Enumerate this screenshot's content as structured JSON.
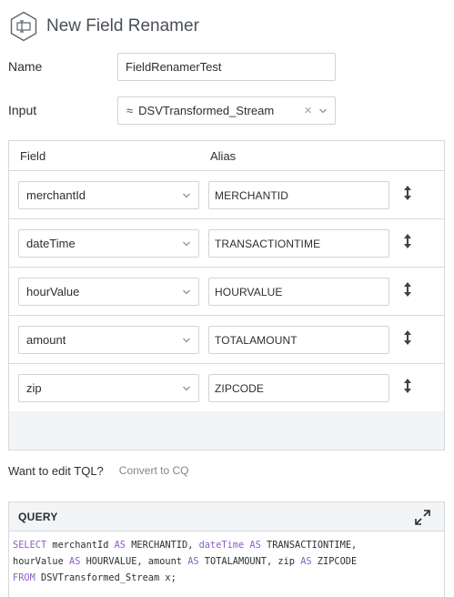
{
  "header": {
    "title": "New Field Renamer",
    "icon": "field-renamer-icon"
  },
  "name": {
    "label": "Name",
    "value": "FieldRenamerTest"
  },
  "input": {
    "label": "Input",
    "value": "DSVTransformed_Stream",
    "stream_icon": "≈",
    "clear_icon": "×"
  },
  "table": {
    "col_field": "Field",
    "col_alias": "Alias",
    "rows": [
      {
        "field": "merchantId",
        "alias": "MERCHANTID"
      },
      {
        "field": "dateTime",
        "alias": "TRANSACTIONTIME"
      },
      {
        "field": "hourValue",
        "alias": "HOURVALUE"
      },
      {
        "field": "amount",
        "alias": "TOTALAMOUNT"
      },
      {
        "field": "zip",
        "alias": "ZIPCODE"
      }
    ]
  },
  "tql": {
    "question": "Want to edit TQL?",
    "link": "Convert to CQ"
  },
  "query": {
    "title": "QUERY",
    "line1": {
      "kw1": "SELECT",
      "t1": " merchantId ",
      "kw2": "AS",
      "t2": " MERCHANTID, ",
      "kw3": "dateTime",
      "t3": " ",
      "kw4": "AS",
      "t4": " TRANSACTIONTIME,"
    },
    "line2": {
      "t1": "hourValue ",
      "kw1": "AS",
      "t2": " HOURVALUE, amount ",
      "kw2": "AS",
      "t3": " TOTALAMOUNT, zip ",
      "kw3": "AS",
      "t4": " ZIPCODE"
    },
    "line3": {
      "kw1": "FROM",
      "t1": " DSVTransformed_Stream x;"
    }
  },
  "colors": {
    "keyword": "#8b5fc9",
    "border": "#d6dade",
    "panel": "#f2f4f5"
  }
}
